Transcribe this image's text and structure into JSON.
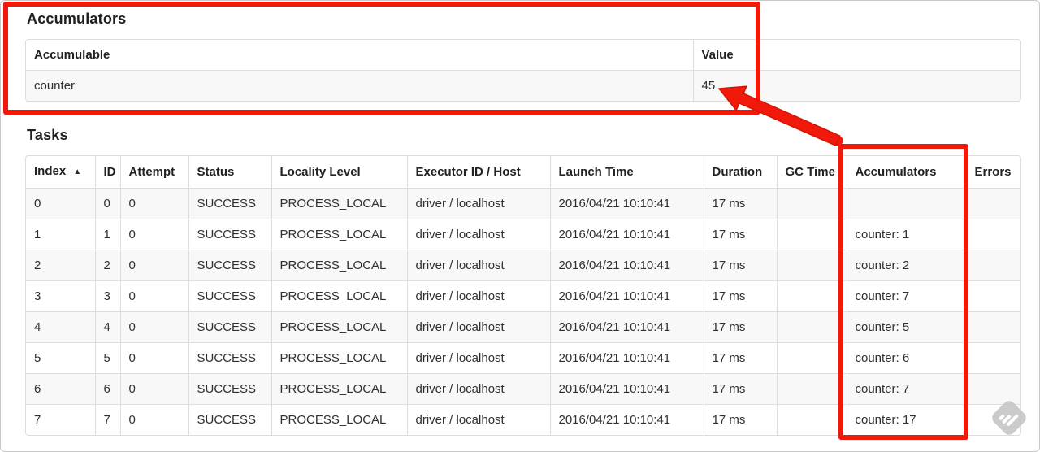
{
  "accumulators_section": {
    "title": "Accumulators",
    "table": {
      "columns": [
        {
          "key": "accumulable",
          "label": "Accumulable"
        },
        {
          "key": "value",
          "label": "Value"
        }
      ],
      "rows": [
        {
          "accumulable": "counter",
          "value": "45"
        }
      ]
    }
  },
  "tasks_section": {
    "title": "Tasks",
    "table": {
      "sort_icon": "▲",
      "sorted_column": "index",
      "columns": [
        {
          "key": "index",
          "label": "Index",
          "sort": "▲"
        },
        {
          "key": "id",
          "label": "ID"
        },
        {
          "key": "attempt",
          "label": "Attempt"
        },
        {
          "key": "status",
          "label": "Status"
        },
        {
          "key": "locality",
          "label": "Locality Level"
        },
        {
          "key": "executor",
          "label": "Executor ID / Host"
        },
        {
          "key": "launch",
          "label": "Launch Time"
        },
        {
          "key": "duration",
          "label": "Duration"
        },
        {
          "key": "gc",
          "label": "GC Time"
        },
        {
          "key": "acc",
          "label": "Accumulators"
        },
        {
          "key": "errors",
          "label": "Errors"
        }
      ],
      "rows": [
        {
          "index": "0",
          "id": "0",
          "attempt": "0",
          "status": "SUCCESS",
          "locality": "PROCESS_LOCAL",
          "executor": "driver / localhost",
          "launch": "2016/04/21 10:10:41",
          "duration": "17 ms",
          "gc": "",
          "acc": "",
          "errors": ""
        },
        {
          "index": "1",
          "id": "1",
          "attempt": "0",
          "status": "SUCCESS",
          "locality": "PROCESS_LOCAL",
          "executor": "driver / localhost",
          "launch": "2016/04/21 10:10:41",
          "duration": "17 ms",
          "gc": "",
          "acc": "counter: 1",
          "errors": ""
        },
        {
          "index": "2",
          "id": "2",
          "attempt": "0",
          "status": "SUCCESS",
          "locality": "PROCESS_LOCAL",
          "executor": "driver / localhost",
          "launch": "2016/04/21 10:10:41",
          "duration": "17 ms",
          "gc": "",
          "acc": "counter: 2",
          "errors": ""
        },
        {
          "index": "3",
          "id": "3",
          "attempt": "0",
          "status": "SUCCESS",
          "locality": "PROCESS_LOCAL",
          "executor": "driver / localhost",
          "launch": "2016/04/21 10:10:41",
          "duration": "17 ms",
          "gc": "",
          "acc": "counter: 7",
          "errors": ""
        },
        {
          "index": "4",
          "id": "4",
          "attempt": "0",
          "status": "SUCCESS",
          "locality": "PROCESS_LOCAL",
          "executor": "driver / localhost",
          "launch": "2016/04/21 10:10:41",
          "duration": "17 ms",
          "gc": "",
          "acc": "counter: 5",
          "errors": ""
        },
        {
          "index": "5",
          "id": "5",
          "attempt": "0",
          "status": "SUCCESS",
          "locality": "PROCESS_LOCAL",
          "executor": "driver / localhost",
          "launch": "2016/04/21 10:10:41",
          "duration": "17 ms",
          "gc": "",
          "acc": "counter: 6",
          "errors": ""
        },
        {
          "index": "6",
          "id": "6",
          "attempt": "0",
          "status": "SUCCESS",
          "locality": "PROCESS_LOCAL",
          "executor": "driver / localhost",
          "launch": "2016/04/21 10:10:41",
          "duration": "17 ms",
          "gc": "",
          "acc": "counter: 7",
          "errors": ""
        },
        {
          "index": "7",
          "id": "7",
          "attempt": "0",
          "status": "SUCCESS",
          "locality": "PROCESS_LOCAL",
          "executor": "driver / localhost",
          "launch": "2016/04/21 10:10:41",
          "duration": "17 ms",
          "gc": "",
          "acc": "counter: 17",
          "errors": ""
        }
      ]
    }
  },
  "annotations": {
    "color": "#f1190b",
    "box_top": "highlights Accumulators summary section",
    "box_column": "highlights Accumulators task column",
    "arrow": "points from task accumulators column to total value 45",
    "watermark_icon": "skitch-icon"
  },
  "colors": {
    "table_border": "#dddddd",
    "row_stripe": "#f8f8f8",
    "text": "#333333"
  }
}
